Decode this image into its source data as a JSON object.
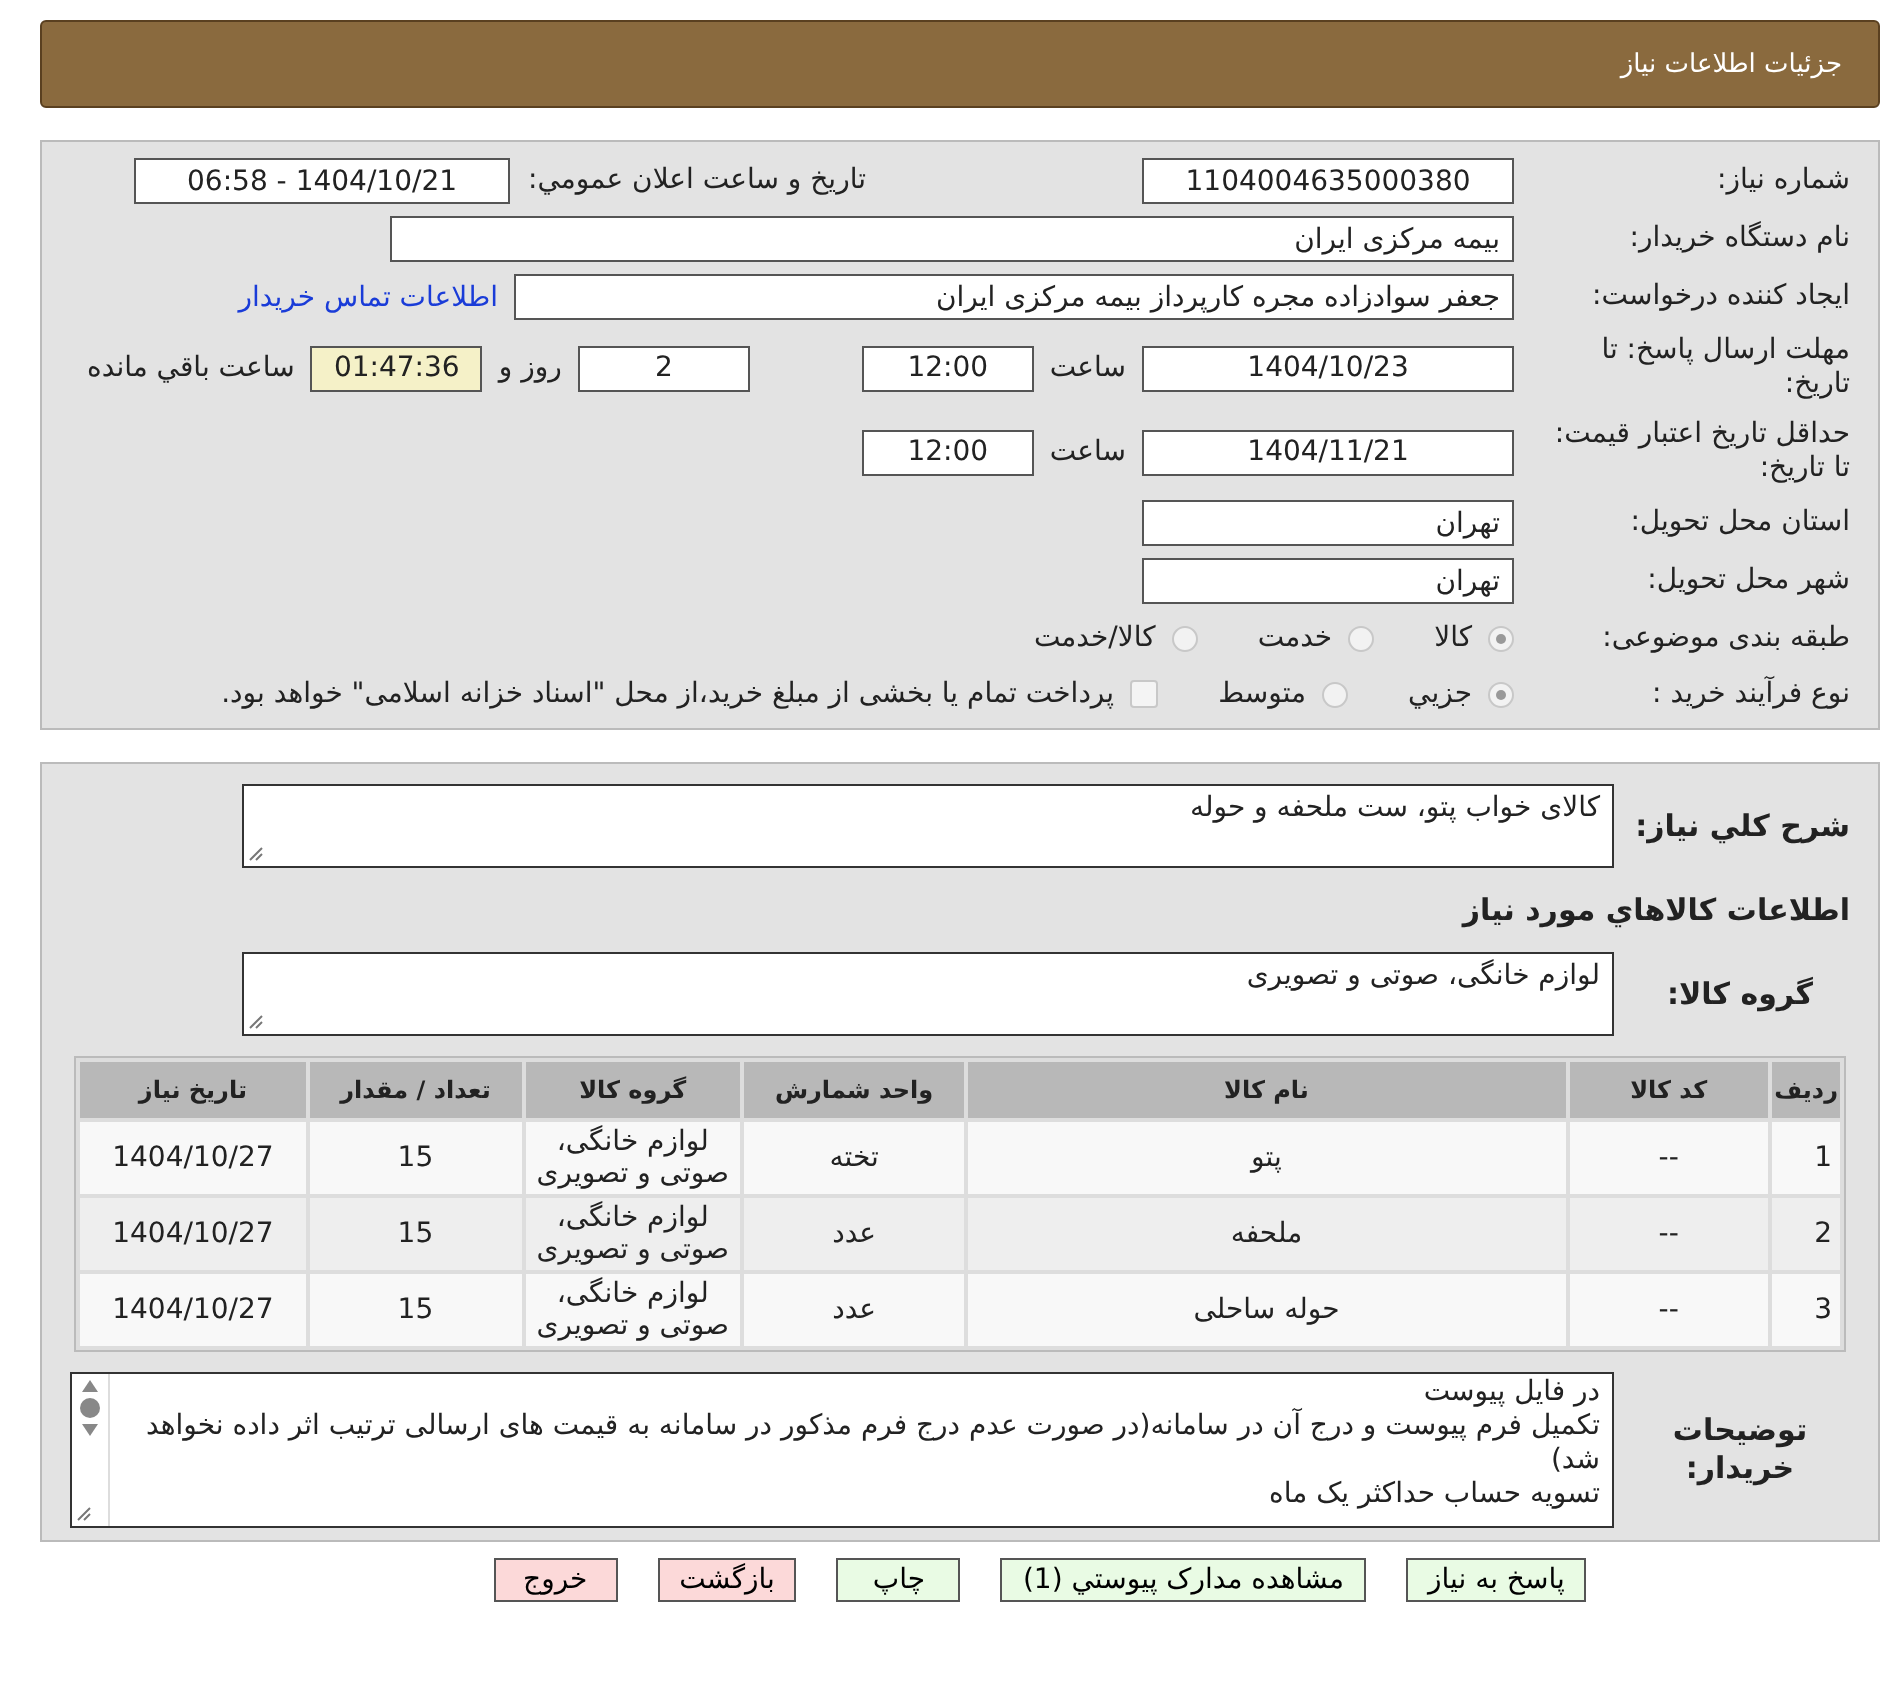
{
  "header": {
    "title": "جزئیات اطلاعات نیاز"
  },
  "details": {
    "need_number": {
      "label": "شماره نیاز:",
      "value": "1104004635000380"
    },
    "announce": {
      "label": "تاریخ و ساعت اعلان عمومي:",
      "value": "1404/10/21 - 06:58"
    },
    "buyer": {
      "label": "نام دستگاه خریدار:",
      "value": "بیمه مرکزی ایران"
    },
    "creator": {
      "label": "ایجاد کننده درخواست:",
      "value": "جعفر سوادزاده مجره کارپرداز بیمه مرکزی ایران",
      "link": "اطلاعات تماس خریدار"
    },
    "deadline": {
      "label": "مهلت ارسال پاسخ: تا تاریخ:",
      "date": "1404/10/23",
      "time_label": "ساعت",
      "time": "12:00",
      "days": "2",
      "days_label": "روز و",
      "remaining": "01:47:36",
      "remaining_label": "ساعت باقي مانده"
    },
    "validity": {
      "label": "حداقل تاریخ اعتبار قیمت: تا تاریخ:",
      "date": "1404/11/21",
      "time_label": "ساعت",
      "time": "12:00"
    },
    "province": {
      "label": "استان محل تحویل:",
      "value": "تهران"
    },
    "city": {
      "label": "شهر محل تحویل:",
      "value": "تهران"
    },
    "category": {
      "label": "طبقه بندی موضوعی:",
      "options": [
        {
          "label": "کالا",
          "selected": true
        },
        {
          "label": "خدمت",
          "selected": false
        },
        {
          "label": "کالا/خدمت",
          "selected": false
        }
      ]
    },
    "process": {
      "label": "نوع فرآیند خرید :",
      "options": [
        {
          "label": "جزيي",
          "selected": true
        },
        {
          "label": "متوسط",
          "selected": false
        }
      ],
      "treasury": {
        "label": "پرداخت تمام یا بخشی از مبلغ خرید،از محل \"اسناد خزانه اسلامی\" خواهد بود.",
        "checked": false
      }
    }
  },
  "need": {
    "summary_label": "شرح كلي نیاز:",
    "summary": "کالای خواب پتو، ست ملحفه و حوله",
    "goods_heading": "اطلاعات كالاهاي مورد نیاز",
    "group_label": "گروه کالا:",
    "group": "لوازم خانگی، صوتی و تصویری",
    "table": {
      "columns": [
        "ردیف",
        "کد کالا",
        "نام کالا",
        "واحد شمارش",
        "گروه کالا",
        "تعداد / مقدار",
        "تاریخ نیاز"
      ],
      "rows": [
        [
          "1",
          "--",
          "پتو",
          "تخته",
          "لوازم خانگی، صوتی و تصویری",
          "15",
          "1404/10/27"
        ],
        [
          "2",
          "--",
          "ملحفه",
          "عدد",
          "لوازم خانگی، صوتی و تصویری",
          "15",
          "1404/10/27"
        ],
        [
          "3",
          "--",
          "حوله ساحلی",
          "عدد",
          "لوازم خانگی، صوتی و تصویری",
          "15",
          "1404/10/27"
        ]
      ]
    },
    "notes_label": "توضیحات خریدار:",
    "notes": [
      "در فایل پیوست",
      "تکمیل فرم پیوست و درج آن در سامانه(در صورت عدم درج فرم مذکور در سامانه به قیمت های ارسالی ترتیب اثر داده نخواهد شد)",
      "تسویه حساب حداکثر یک ماه"
    ]
  },
  "buttons": [
    {
      "label": "پاسخ به نیاز",
      "color": "#e9fbe4"
    },
    {
      "label": "مشاهده مدارک پیوستي (1)",
      "color": "#e9fbe4"
    },
    {
      "label": "چاپ",
      "color": "#e9fbe4"
    },
    {
      "label": "بازگشت",
      "color": "#fcd9d9"
    },
    {
      "label": "خروج",
      "color": "#fcd9d9"
    }
  ]
}
